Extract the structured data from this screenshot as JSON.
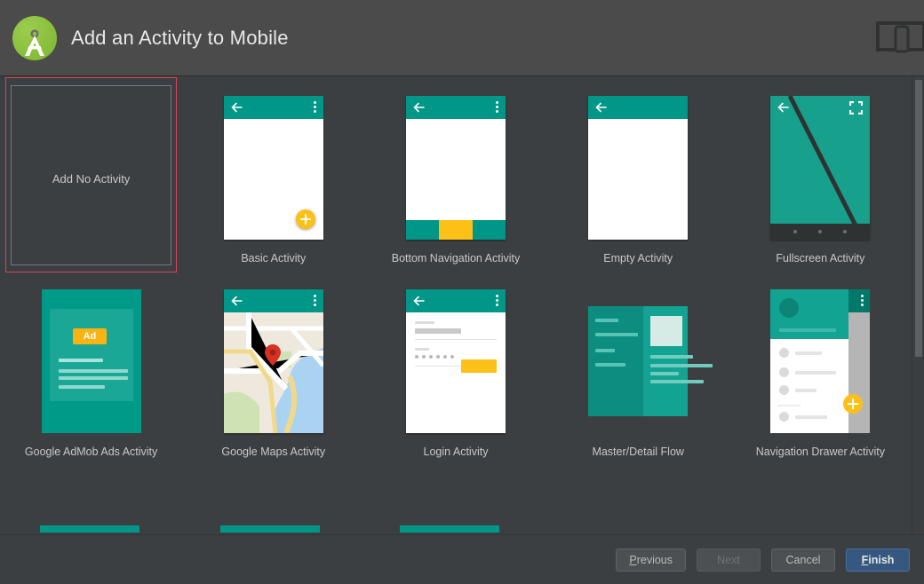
{
  "header": {
    "title": "Add an Activity to Mobile",
    "logo_icon": "android-studio-logo-icon",
    "watermark_icon": "device-preview-icon"
  },
  "gallery": {
    "scrollbar_icon": "vertical-scrollbar",
    "no_activity": {
      "label": "Add No Activity",
      "selected": true
    },
    "items": [
      {
        "label": "Basic Activity",
        "thumb": "basic-activity-thumb"
      },
      {
        "label": "Bottom Navigation Activity",
        "thumb": "bottom-navigation-activity-thumb"
      },
      {
        "label": "Empty Activity",
        "thumb": "empty-activity-thumb"
      },
      {
        "label": "Fullscreen Activity",
        "thumb": "fullscreen-activity-thumb"
      },
      {
        "label": "Google AdMob Ads Activity",
        "thumb": "google-admob-ads-activity-thumb"
      },
      {
        "label": "Google Maps Activity",
        "thumb": "google-maps-activity-thumb"
      },
      {
        "label": "Login Activity",
        "thumb": "login-activity-thumb"
      },
      {
        "label": "Master/Detail Flow",
        "thumb": "master-detail-flow-thumb"
      },
      {
        "label": "Navigation Drawer Activity",
        "thumb": "navigation-drawer-activity-thumb"
      }
    ],
    "admob_badge": "Ad"
  },
  "footer": {
    "previous": "Previous",
    "previous_mnemonic": "P",
    "next": "Next",
    "cancel": "Cancel",
    "finish": "Finish",
    "finish_mnemonic": "F"
  },
  "colors": {
    "dialog_bg": "#3c3f41",
    "header_bg": "#4b4b4b",
    "accent_teal": "#009688",
    "accent_amber": "#fcc016",
    "selection_red": "#d9435f",
    "default_button_blue": "#365880",
    "logo_green": "#8dc63f"
  }
}
